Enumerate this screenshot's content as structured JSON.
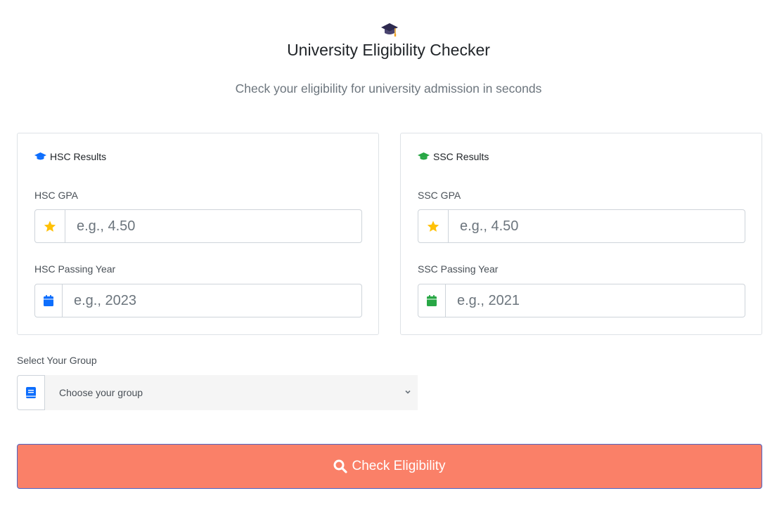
{
  "header": {
    "icon": "graduation-cap-icon",
    "title": "University Eligibility Checker",
    "subtitle": "Check your eligibility for university admission in seconds"
  },
  "hsc": {
    "title": "HSC Results",
    "icon": "graduation-cap-icon",
    "icon_color": "#0d6efd",
    "gpa_label": "HSC GPA",
    "gpa_placeholder": "e.g., 4.50",
    "gpa_icon": "star-icon",
    "year_label": "HSC Passing Year",
    "year_placeholder": "e.g., 2023",
    "year_icon": "calendar-icon",
    "year_icon_color": "#0d6efd"
  },
  "ssc": {
    "title": "SSC Results",
    "icon": "graduation-cap-icon",
    "icon_color": "#28a745",
    "gpa_label": "SSC GPA",
    "gpa_placeholder": "e.g., 4.50",
    "gpa_icon": "star-icon",
    "year_label": "SSC Passing Year",
    "year_placeholder": "e.g., 2021",
    "year_icon": "calendar-icon",
    "year_icon_color": "#28a745"
  },
  "group": {
    "label": "Select Your Group",
    "selected": "Choose your group",
    "icon": "book-icon"
  },
  "submit": {
    "label": "Check Eligibility",
    "icon": "search-icon",
    "color": "#fa8068"
  },
  "colors": {
    "star": "#ffc107",
    "header_cap": "#2e2a4f"
  }
}
